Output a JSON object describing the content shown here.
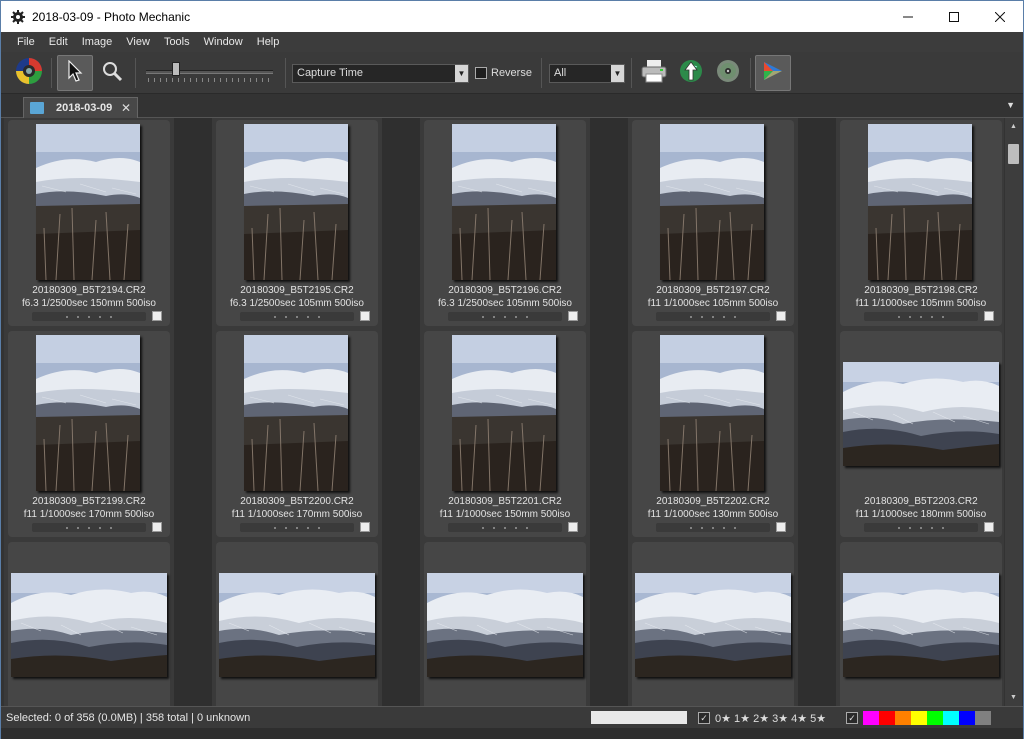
{
  "window": {
    "title": "2018-03-09 - Photo Mechanic",
    "controls": [
      "minimize",
      "maximize",
      "close"
    ]
  },
  "menu": [
    "File",
    "Edit",
    "Image",
    "View",
    "Tools",
    "Window",
    "Help"
  ],
  "toolbar": {
    "sort_field": "Capture Time",
    "reverse_label": "Reverse",
    "reverse_checked": false,
    "filter": "All",
    "icons": [
      "color-wheel-icon",
      "pointer-icon",
      "magnifier-icon",
      "printer-icon",
      "upload-icon",
      "burn-disc-icon",
      "share-icon"
    ]
  },
  "tab": {
    "label": "2018-03-09",
    "close": "✕",
    "menu_arrow": "▼"
  },
  "photos": [
    {
      "filename": "20180309_B5T2194.CR2",
      "exif": "f6.3 1/2500sec 150mm 500iso",
      "orientation": "portrait"
    },
    {
      "filename": "20180309_B5T2195.CR2",
      "exif": "f6.3 1/2500sec 105mm 500iso",
      "orientation": "portrait"
    },
    {
      "filename": "20180309_B5T2196.CR2",
      "exif": "f6.3 1/2500sec 105mm 500iso",
      "orientation": "portrait"
    },
    {
      "filename": "20180309_B5T2197.CR2",
      "exif": "f11 1/1000sec 105mm 500iso",
      "orientation": "portrait"
    },
    {
      "filename": "20180309_B5T2198.CR2",
      "exif": "f11 1/1000sec 105mm 500iso",
      "orientation": "portrait"
    },
    {
      "filename": "20180309_B5T2199.CR2",
      "exif": "f11 1/1000sec 170mm 500iso",
      "orientation": "portrait"
    },
    {
      "filename": "20180309_B5T2200.CR2",
      "exif": "f11 1/1000sec 170mm 500iso",
      "orientation": "portrait"
    },
    {
      "filename": "20180309_B5T2201.CR2",
      "exif": "f11 1/1000sec 150mm 500iso",
      "orientation": "portrait"
    },
    {
      "filename": "20180309_B5T2202.CR2",
      "exif": "f11 1/1000sec 130mm 500iso",
      "orientation": "portrait"
    },
    {
      "filename": "20180309_B5T2203.CR2",
      "exif": "f11 1/1000sec 180mm 500iso",
      "orientation": "landscape"
    },
    {
      "filename": "",
      "exif": "",
      "orientation": "landscape"
    },
    {
      "filename": "",
      "exif": "",
      "orientation": "landscape"
    },
    {
      "filename": "",
      "exif": "",
      "orientation": "landscape"
    },
    {
      "filename": "",
      "exif": "",
      "orientation": "landscape"
    },
    {
      "filename": "",
      "exif": "",
      "orientation": "landscape"
    }
  ],
  "status": {
    "text": "Selected: 0 of 358 (0.0MB) | 358 total | 0 unknown",
    "star_filter": "0★ 1★ 2★ 3★ 4★ 5★",
    "color_classes": [
      "#ff00ff",
      "#ff0000",
      "#ff8000",
      "#ffff00",
      "#00ff00",
      "#00ffff",
      "#0000ff",
      "#808080"
    ]
  }
}
